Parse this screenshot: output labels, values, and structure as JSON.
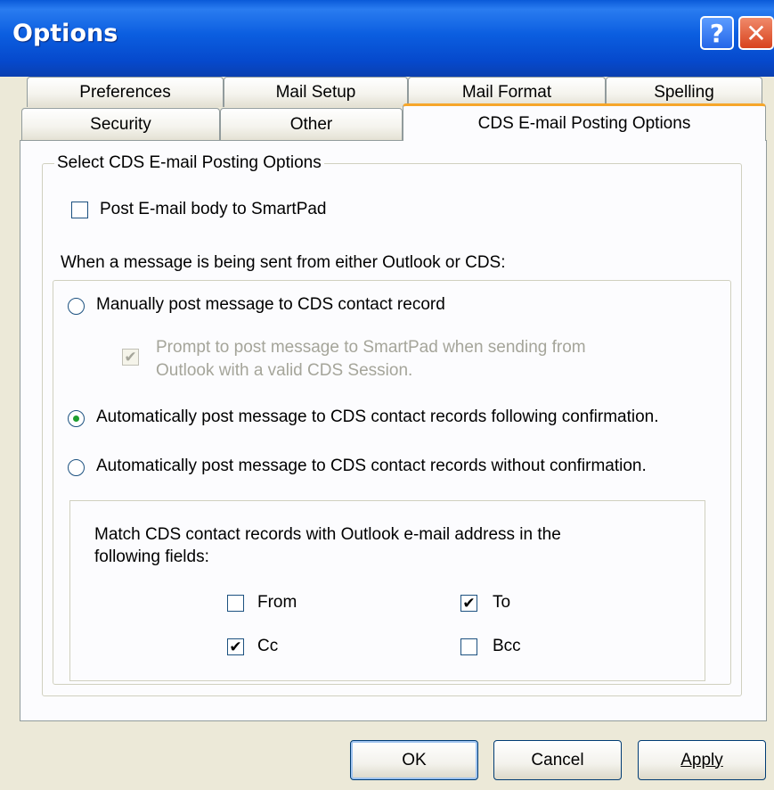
{
  "window": {
    "title": "Options",
    "help_symbol": "?",
    "close_symbol": "✕",
    "accent_color": "#0a5ad8",
    "tab_accent_color": "#f6a62a"
  },
  "tabs_row1": [
    "Preferences",
    "Mail Setup",
    "Mail Format",
    "Spelling"
  ],
  "tabs_row2": [
    "Security",
    "Other",
    "CDS E-mail Posting Options"
  ],
  "active_tab": "CDS E-mail Posting Options",
  "group": {
    "legend": "Select CDS E-mail Posting Options",
    "post_body_label": "Post E-mail body to SmartPad",
    "post_body_checked": false,
    "when_sent_label": "When a message is being sent from either Outlook or CDS:",
    "radio_manual_label": "Manually post message to CDS contact record",
    "radio_manual_selected": false,
    "prompt_label_line1": "Prompt to post message to SmartPad when sending from",
    "prompt_label_line2": "Outlook with a valid CDS Session.",
    "prompt_checked": true,
    "prompt_enabled": false,
    "radio_confirm_label": "Automatically post message to CDS contact records following confirmation.",
    "radio_confirm_selected": true,
    "radio_noconfirm_label": "Automatically post message to CDS contact records without confirmation.",
    "radio_noconfirm_selected": false,
    "match_line1": "Match CDS contact records with Outlook e-mail address in the",
    "match_line2": "following fields:",
    "fields": {
      "from": {
        "label": "From",
        "checked": false
      },
      "to": {
        "label": "To",
        "checked": true
      },
      "cc": {
        "label": "Cc",
        "checked": true
      },
      "bcc": {
        "label": "Bcc",
        "checked": false
      }
    },
    "check_mark": "✔"
  },
  "buttons": {
    "ok": "OK",
    "cancel": "Cancel",
    "apply": "Apply"
  }
}
